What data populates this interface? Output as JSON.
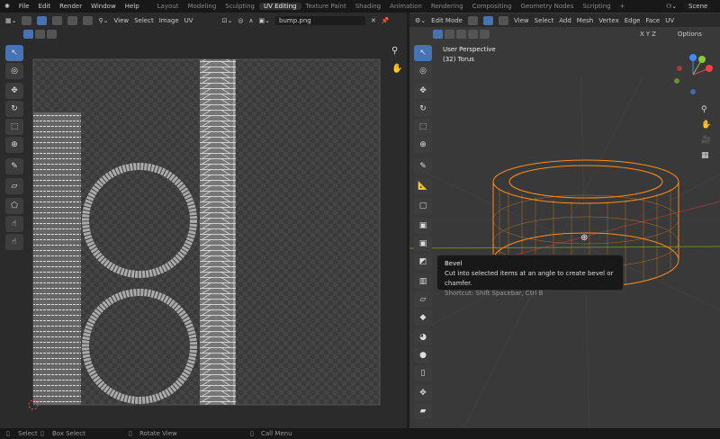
{
  "menu": [
    "File",
    "Edit",
    "Render",
    "Window",
    "Help"
  ],
  "workspaces": [
    "Layout",
    "Modeling",
    "Sculpting",
    "UV Editing",
    "Texture Paint",
    "Shading",
    "Animation",
    "Rendering",
    "Compositing",
    "Geometry Nodes",
    "Scripting",
    "+"
  ],
  "active_workspace": "UV Editing",
  "scene": "Scene",
  "uv_editor": {
    "menus": [
      "View",
      "Select",
      "Image",
      "UV"
    ],
    "image_name": "bump.png"
  },
  "viewport": {
    "mode": "Edit Mode",
    "menus": [
      "View",
      "Select",
      "Add",
      "Mesh",
      "Vertex",
      "Edge",
      "Face",
      "UV"
    ],
    "axes": [
      "X",
      "Y",
      "Z"
    ],
    "options": "Options",
    "view_name": "User Perspective",
    "object_info": "(32) Torus"
  },
  "tooltip": {
    "title": "Bevel",
    "description": "Cut into selected items at an angle to create bevel or chamfer.",
    "shortcut": "Shortcut: Shift Spacebar, Ctrl B"
  },
  "status": {
    "select": "Select",
    "box_select": "Box Select",
    "rotate": "Rotate View",
    "call_menu": "Call Menu"
  },
  "colors": {
    "accent": "#4772b3",
    "wire": "#ff8c1a"
  }
}
